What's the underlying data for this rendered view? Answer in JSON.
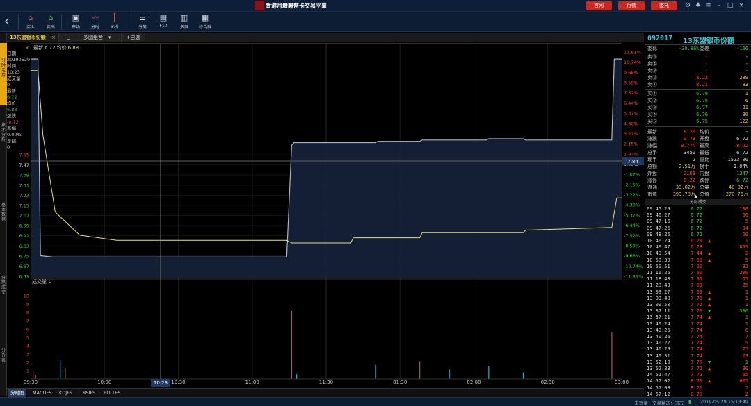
{
  "window": {
    "title": "香港月增聯幣卡交易平臺",
    "buttons": [
      {
        "label": "官网"
      },
      {
        "label": "行情"
      },
      {
        "label": "委托"
      }
    ]
  },
  "toolbar": {
    "items": [
      {
        "label": "买入",
        "icon": "buy-icon",
        "glyph": "⌂",
        "color": "#e05050"
      },
      {
        "label": "卖出",
        "icon": "sell-icon",
        "glyph": "⌂",
        "color": "#50c050"
      },
      {
        "label": "市场",
        "icon": "market-icon",
        "glyph": "▣",
        "color": "#d8dde6"
      },
      {
        "label": "分时",
        "icon": "timeshare-icon",
        "glyph": "〰",
        "color": "#e06060"
      },
      {
        "label": "K线",
        "icon": "kline-icon",
        "glyph": "┃",
        "color": "#e06060"
      },
      {
        "label": "分笔",
        "icon": "tick-icon",
        "glyph": "☰",
        "color": "#d8dde6"
      },
      {
        "label": "F10",
        "icon": "f10-icon",
        "glyph": "▤",
        "color": "#d8dde6"
      },
      {
        "label": "多屏",
        "icon": "multi-screen-icon",
        "glyph": "▥",
        "color": "#d8dde6"
      },
      {
        "label": "综合屏",
        "icon": "composite-screen-icon",
        "glyph": "▦",
        "color": "#d8dde6"
      }
    ]
  },
  "tabbar": {
    "stock": "13东盟银币份额",
    "period": "一日",
    "chart_mode": "多图组合",
    "add": "+自选"
  },
  "sidebar": {
    "tabs": [
      "分时走势",
      "技术分析",
      "基本数据",
      "分笔成交",
      "分价表"
    ]
  },
  "info": {
    "date_label": "日期",
    "date": "20190529",
    "time_label": "时间",
    "time": "10:23",
    "vol_label": "成交量",
    "vol": "0",
    "latest_label": "最新",
    "latest": "6.72",
    "avg_label": "均价",
    "avg": "6.88",
    "change_label": "涨跌",
    "change": "-0.72",
    "pct_label": "涨幅",
    "pct": "0.00%",
    "amount_label": "总额",
    "amount": "0"
  },
  "chart_data": {
    "type": "line",
    "legend_prefix": "最新",
    "legend_latest": "6.72",
    "legend_avg_label": "均价",
    "legend_avg": "6.88",
    "volume_title": "成交量",
    "volume_value": "0",
    "xticks": [
      "09:30",
      "10:00",
      "10:30",
      "11:00",
      "11:30",
      "01:30",
      "02:00",
      "02:30",
      "03:00"
    ],
    "cursor_label": "10:23",
    "y_left_ticks": [
      "7.55",
      "7.47",
      "7.39",
      "7.31",
      "7.23",
      "7.15",
      "7.07",
      "6.99",
      "6.91",
      "6.83",
      "6.75",
      "6.67",
      "6.59"
    ],
    "y_left_base": "7.47",
    "y_right_ticks": [
      "11.81%",
      "10.74%",
      "9.66%",
      "8.59%",
      "7.52%",
      "6.44%",
      "5.37%",
      "4.30%",
      "3.22%",
      "2.15%",
      "1.07%",
      "0.00%",
      "-1.07%",
      "-2.15%",
      "-3.22%",
      "-4.30%",
      "-5.37%",
      "-6.44%",
      "-7.52%",
      "-8.59%",
      "-9.66%",
      "-10.74%",
      "-11.81%"
    ],
    "y_cursor_label": "7.84",
    "vol_yticks": [
      "10",
      "9",
      "8",
      "7",
      "6",
      "5",
      "4",
      "3",
      "2",
      "1"
    ],
    "ylim": [
      6.59,
      8.35
    ],
    "price_series": [
      {
        "t": 0,
        "v": 8.29
      },
      {
        "t": 3,
        "v": 8.29
      },
      {
        "t": 4,
        "v": 6.76
      },
      {
        "t": 9,
        "v": 6.75
      },
      {
        "t": 100,
        "v": 6.75
      },
      {
        "t": 104,
        "v": 6.75
      },
      {
        "t": 106,
        "v": 7.62
      },
      {
        "t": 107,
        "v": 7.64
      },
      {
        "t": 140,
        "v": 7.64
      },
      {
        "t": 141,
        "v": 7.65
      },
      {
        "t": 158,
        "v": 7.65
      },
      {
        "t": 159,
        "v": 7.66
      },
      {
        "t": 185,
        "v": 7.66
      },
      {
        "t": 186,
        "v": 7.67
      },
      {
        "t": 200,
        "v": 7.67
      },
      {
        "t": 201,
        "v": 7.66
      },
      {
        "t": 236,
        "v": 7.66
      },
      {
        "t": 237,
        "v": 8.29
      },
      {
        "t": 240,
        "v": 8.29
      }
    ],
    "avg_series": [
      {
        "t": 0,
        "v": 8.2
      },
      {
        "t": 3,
        "v": 8.2
      },
      {
        "t": 5,
        "v": 7.7
      },
      {
        "t": 10,
        "v": 7.1
      },
      {
        "t": 20,
        "v": 6.92
      },
      {
        "t": 35,
        "v": 6.88
      },
      {
        "t": 104,
        "v": 6.88
      },
      {
        "t": 106,
        "v": 6.86
      },
      {
        "t": 130,
        "v": 6.86
      },
      {
        "t": 131,
        "v": 6.9
      },
      {
        "t": 158,
        "v": 6.9
      },
      {
        "t": 159,
        "v": 6.94
      },
      {
        "t": 200,
        "v": 6.94
      },
      {
        "t": 201,
        "v": 6.96
      },
      {
        "t": 236,
        "v": 6.98
      },
      {
        "t": 238,
        "v": 7.21
      },
      {
        "t": 240,
        "v": 7.21
      }
    ],
    "volume": [
      {
        "t": 1,
        "v": 1.0,
        "c": "#e04040"
      },
      {
        "t": 2,
        "v": 0.5,
        "c": "#e04040"
      },
      {
        "t": 12,
        "v": 2.4,
        "c": "#2ab0c8"
      },
      {
        "t": 14,
        "v": 1.4,
        "c": "#e6c73a"
      },
      {
        "t": 106,
        "v": 8.6,
        "c": "#e04040"
      },
      {
        "t": 108,
        "v": 0.6,
        "c": "#2ab0c8"
      },
      {
        "t": 140,
        "v": 1.8,
        "c": "#2ab0c8"
      },
      {
        "t": 158,
        "v": 2.2,
        "c": "#e04040"
      },
      {
        "t": 170,
        "v": 1.2,
        "c": "#2ab0c8"
      },
      {
        "t": 186,
        "v": 1.6,
        "c": "#2ab0c8"
      },
      {
        "t": 200,
        "v": 0.8,
        "c": "#2ab0c8"
      },
      {
        "t": 236,
        "v": 5.9,
        "c": "#e04040"
      }
    ]
  },
  "bottom_tabs": [
    "分时图",
    "MACDFS",
    "KDJFS",
    "RSIFS",
    "BOLLFS"
  ],
  "quote": {
    "code": "092017",
    "name": "13东盟银币份额",
    "wb_label": "委比",
    "wb": "-30.86%",
    "wc_label": "委差",
    "wc": "-166",
    "asks": [
      {
        "label": "卖⑤",
        "price": "-",
        "vol": "-"
      },
      {
        "label": "卖④",
        "price": "-",
        "vol": "-"
      },
      {
        "label": "卖③",
        "price": "-",
        "vol": "-"
      },
      {
        "label": "卖②",
        "price": "8.22",
        "vol": "289"
      },
      {
        "label": "卖①",
        "price": "8.21",
        "vol": "83"
      }
    ],
    "bids": [
      {
        "label": "买①",
        "price": "6.79",
        "vol": "1"
      },
      {
        "label": "买②",
        "price": "6.78",
        "vol": "6"
      },
      {
        "label": "买③",
        "price": "6.77",
        "vol": "21"
      },
      {
        "label": "买④",
        "price": "6.76",
        "vol": "30"
      },
      {
        "label": "买⑤",
        "price": "6.75",
        "vol": "122"
      }
    ],
    "stats": [
      {
        "l1": "最新",
        "v1": "8.20",
        "c1": "#ff4040",
        "l2": "均价",
        "v2": "-",
        "c2": "#ddd"
      },
      {
        "l1": "涨跌",
        "v1": "0.73",
        "c1": "#ff4040",
        "l2": "开盘",
        "v2": "6.72",
        "c2": "#ddd"
      },
      {
        "l1": "涨幅",
        "v1": "9.77%",
        "c1": "#ff4040",
        "l2": "最高",
        "v2": "8.22",
        "c2": "#ff4040"
      },
      {
        "l1": "总手",
        "v1": "3450",
        "c1": "#ddd",
        "l2": "最低",
        "v2": "6.72",
        "c2": "#ddd"
      },
      {
        "l1": "现手",
        "v1": "2",
        "c1": "#ddd",
        "l2": "量比",
        "v2": "1523.00",
        "c2": "#ddd"
      },
      {
        "l1": "总额",
        "v1": "2.51万",
        "c1": "#e6c73a",
        "l2": "换手",
        "v2": "1.04%",
        "c2": "#ddd"
      },
      {
        "l1": "外盘",
        "v1": "2103",
        "c1": "#ff4040",
        "l2": "内盘",
        "v2": "1347",
        "c2": "#38d038"
      },
      {
        "l1": "涨停",
        "v1": "8.22",
        "c1": "#ff4040",
        "l2": "跌停",
        "v2": "6.72",
        "c2": "#38d038"
      },
      {
        "l1": "流通",
        "v1": "33.02万",
        "c1": "#e6c73a",
        "l2": "总量",
        "v2": "40.02万",
        "c2": "#e6c73a"
      },
      {
        "l1": "市值",
        "v1": "393.70万",
        "c1": "#e6c73a",
        "l2": "总值",
        "v2": "270.76万",
        "c2": "#e6c73a"
      }
    ],
    "ticks_header": "分时成交",
    "ticks": [
      {
        "time": "09:45:29",
        "price": "6.72",
        "dir": "",
        "vol": "100"
      },
      {
        "time": "09:46:27",
        "price": "6.72",
        "dir": "",
        "vol": "50"
      },
      {
        "time": "09:47:16",
        "price": "6.72",
        "dir": "",
        "vol": "5"
      },
      {
        "time": "09:47:26",
        "price": "6.72",
        "dir": "",
        "vol": "34"
      },
      {
        "time": "09:48:26",
        "price": "6.72",
        "dir": "",
        "vol": "50"
      },
      {
        "time": "10:46:24",
        "price": "6.78",
        "dir": "▲",
        "vol": "1"
      },
      {
        "time": "10:49:47",
        "price": "6.78",
        "dir": "",
        "vol": "853"
      },
      {
        "time": "10:49:54",
        "price": "7.44",
        "dir": "▲",
        "vol": "2"
      },
      {
        "time": "10:50:39",
        "price": "7.60",
        "dir": "▲",
        "vol": "5"
      },
      {
        "time": "10:50:51",
        "price": "7.60",
        "dir": "",
        "vol": "32"
      },
      {
        "time": "11:16:26",
        "price": "7.60",
        "dir": "",
        "vol": "200"
      },
      {
        "time": "11:18:48",
        "price": "7.60",
        "dir": "",
        "vol": "65"
      },
      {
        "time": "11:29:43",
        "price": "7.60",
        "dir": "",
        "vol": "25"
      },
      {
        "time": "13:09:27",
        "price": "7.69",
        "dir": "▲",
        "vol": "1"
      },
      {
        "time": "13:09:48",
        "price": "7.70",
        "dir": "▲",
        "vol": "1"
      },
      {
        "time": "13:09:50",
        "price": "7.72",
        "dir": "▲",
        "vol": "1"
      },
      {
        "time": "13:37:11",
        "price": "7.70",
        "dir": "▼",
        "vol": "300"
      },
      {
        "time": "13:37:21",
        "price": "7.74",
        "dir": "▲",
        "vol": "1"
      },
      {
        "time": "13:40:24",
        "price": "7.74",
        "dir": "",
        "vol": "1"
      },
      {
        "time": "13:40:25",
        "price": "7.74",
        "dir": "",
        "vol": "6"
      },
      {
        "time": "13:40:26",
        "price": "7.74",
        "dir": "",
        "vol": "7"
      },
      {
        "time": "13:40:27",
        "price": "7.74",
        "dir": "",
        "vol": "5"
      },
      {
        "time": "13:40:29",
        "price": "7.74",
        "dir": "",
        "vol": "25"
      },
      {
        "time": "13:40:31",
        "price": "7.74",
        "dir": "",
        "vol": "23"
      },
      {
        "time": "13:52:19",
        "price": "7.70",
        "dir": "▼",
        "vol": "1"
      },
      {
        "time": "13:52:33",
        "price": "7.72",
        "dir": "▲",
        "vol": "36"
      },
      {
        "time": "14:51:47",
        "price": "7.72",
        "dir": "",
        "vol": "65"
      },
      {
        "time": "14:57:02",
        "price": "8.20",
        "dir": "▲",
        "vol": "602"
      },
      {
        "time": "14:57:08",
        "price": "8.20",
        "dir": "",
        "vol": "1"
      },
      {
        "time": "14:57:12",
        "price": "8.20",
        "dir": "",
        "vol": "2"
      }
    ]
  },
  "status": {
    "login": "未登录",
    "trade_status_label": "交易状态：",
    "trade_status": "闭市",
    "datetime": "2019-05-29 15:13:49"
  },
  "colors": {
    "up": "#ff4040",
    "down": "#38d038",
    "price_line": "#a8b4cc",
    "avg_line": "#e6e07a",
    "accent": "#e6a817"
  }
}
